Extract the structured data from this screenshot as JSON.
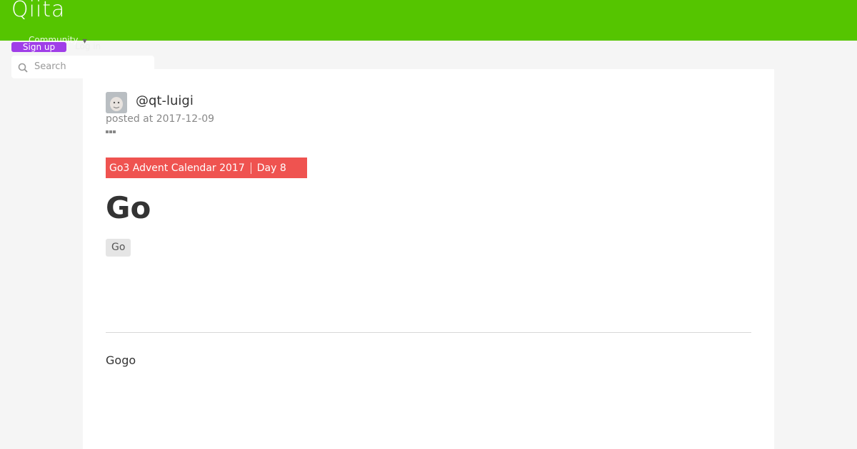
{
  "header": {
    "logo": "Qiita",
    "community_label": "Community",
    "signup_label": "Sign up",
    "login_label": "Log in",
    "search": {
      "placeholder": "Search",
      "icon": "search-icon"
    },
    "brand_color": "#55c500",
    "signup_color": "#a03ee8"
  },
  "article": {
    "author": "@qt-luigi",
    "posted_at": "posted at 2017-12-09",
    "advent_calendar": {
      "name": "Go3 Advent Calendar 2017",
      "day": "Day 8",
      "color": "#ef5350"
    },
    "title": "Go",
    "tags": [
      "Go"
    ],
    "body": "Gogo"
  }
}
